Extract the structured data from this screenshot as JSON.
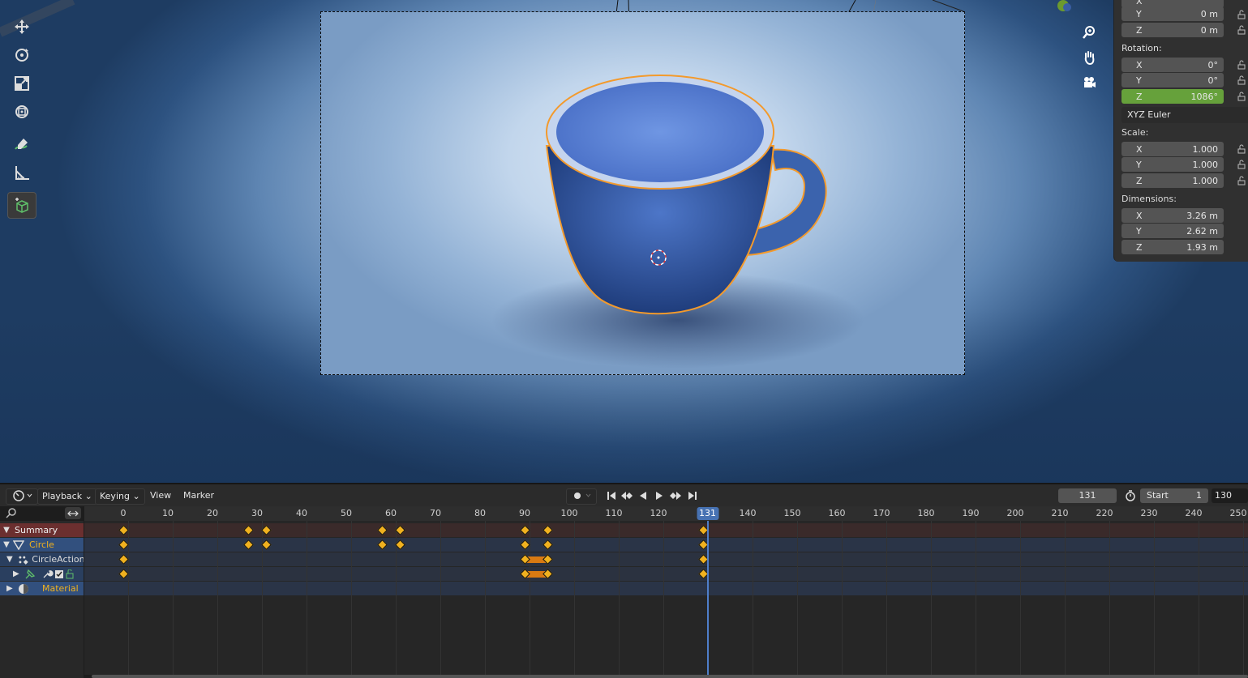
{
  "viewport": {
    "tools": [
      {
        "name": "move-icon"
      },
      {
        "name": "rotate-icon"
      },
      {
        "name": "scale-icon"
      },
      {
        "name": "transform-icon"
      },
      {
        "name": "annotate-icon"
      },
      {
        "name": "measure-icon"
      },
      {
        "name": "add-cube-icon"
      }
    ],
    "nav": [
      "zoom-icon",
      "hand-pan-icon",
      "camera-icon"
    ]
  },
  "npanel": {
    "location": {
      "y": "0 m",
      "z": "0 m"
    },
    "rotation_label": "Rotation:",
    "rotation": {
      "x": "0°",
      "y": "0°",
      "z": "1086°"
    },
    "rotation_mode": "XYZ Euler",
    "scale_label": "Scale:",
    "scale": {
      "x": "1.000",
      "y": "1.000",
      "z": "1.000"
    },
    "dimensions_label": "Dimensions:",
    "dimensions": {
      "x": "3.26 m",
      "y": "2.62 m",
      "z": "1.93 m"
    },
    "axis": {
      "x": "X",
      "y": "Y",
      "z": "Z"
    },
    "highlight_color": "#66a13b"
  },
  "dopesheet": {
    "menus": {
      "playback": "Playback",
      "keying": "Keying",
      "view": "View",
      "marker": "Marker"
    },
    "current_frame": "131",
    "start_label": "Start",
    "start_value": "1",
    "end_value": "130",
    "ruler_ticks": [
      0,
      10,
      20,
      30,
      40,
      50,
      60,
      70,
      80,
      90,
      100,
      110,
      120,
      131,
      140,
      150,
      160,
      170,
      180,
      190,
      200,
      210,
      220,
      230,
      240,
      250
    ],
    "playhead_frame": 131,
    "channels": [
      {
        "label": "Summary"
      },
      {
        "label": "Circle"
      },
      {
        "label": "CircleAction"
      },
      {
        "label": ""
      },
      {
        "label": "Material"
      }
    ],
    "keyframes": {
      "summary": [
        0,
        28,
        32,
        58,
        62,
        90,
        95,
        130
      ],
      "circle": [
        0,
        28,
        32,
        58,
        62,
        90,
        95,
        130
      ],
      "action": [
        0,
        90,
        95,
        130
      ],
      "sub": [
        0,
        90,
        95,
        130
      ]
    },
    "holds": [
      {
        "row": "action",
        "from": 90,
        "to": 95
      },
      {
        "row": "sub",
        "from": 90,
        "to": 95
      }
    ],
    "accent_color": "#4772b3",
    "keyframe_color": "#f0b11f"
  }
}
